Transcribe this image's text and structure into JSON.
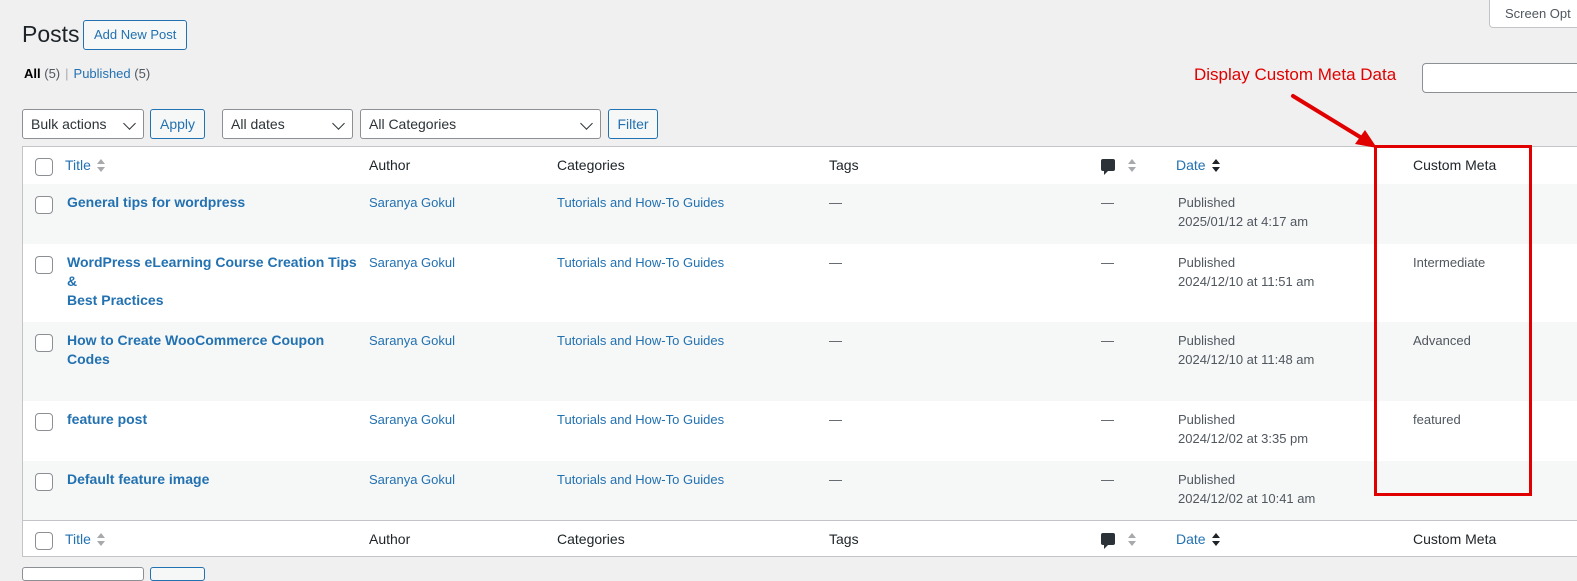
{
  "header": {
    "title": "Posts",
    "add_new_label": "Add New Post",
    "screen_options_label": "Screen Opt"
  },
  "views": {
    "all_label": "All",
    "all_count": "(5)",
    "separator": "|",
    "published_label": "Published",
    "published_count": "(5)"
  },
  "annotation": {
    "text": "Display Custom Meta Data",
    "color": "#e00000"
  },
  "filters": {
    "bulk_actions": "Bulk actions",
    "apply_label": "Apply",
    "dates": "All dates",
    "categories": "All Categories",
    "filter_label": "Filter"
  },
  "columns": {
    "title": "Title",
    "author": "Author",
    "categories": "Categories",
    "tags": "Tags",
    "comments_icon": "comment-bubble-icon",
    "date": "Date",
    "custom_meta": "Custom Meta"
  },
  "rows": [
    {
      "title_line1": "General tips for wordpress",
      "title_line2": "",
      "author": "Saranya Gokul",
      "category": "Tutorials and How-To Guides",
      "tags": "—",
      "comments": "—",
      "status": "Published",
      "date": "2025/01/12 at 4:17 am",
      "custom_meta": ""
    },
    {
      "title_line1": "WordPress eLearning Course Creation Tips &",
      "title_line2": "Best Practices",
      "author": "Saranya Gokul",
      "category": "Tutorials and How-To Guides",
      "tags": "—",
      "comments": "—",
      "status": "Published",
      "date": "2024/12/10 at 11:51 am",
      "custom_meta": "Intermediate"
    },
    {
      "title_line1": "How to Create WooCommerce Coupon",
      "title_line2": "Codes",
      "author": "Saranya Gokul",
      "category": "Tutorials and How-To Guides",
      "tags": "—",
      "comments": "—",
      "status": "Published",
      "date": "2024/12/10 at 11:48 am",
      "custom_meta": "Advanced"
    },
    {
      "title_line1": "feature post",
      "title_line2": "",
      "author": "Saranya Gokul",
      "category": "Tutorials and How-To Guides",
      "tags": "—",
      "comments": "—",
      "status": "Published",
      "date": "2024/12/02 at 3:35 pm",
      "custom_meta": "featured"
    },
    {
      "title_line1": "Default feature image",
      "title_line2": "",
      "author": "Saranya Gokul",
      "category": "Tutorials and How-To Guides",
      "tags": "—",
      "comments": "—",
      "status": "Published",
      "date": "2024/12/02 at 10:41 am",
      "custom_meta": ""
    }
  ]
}
